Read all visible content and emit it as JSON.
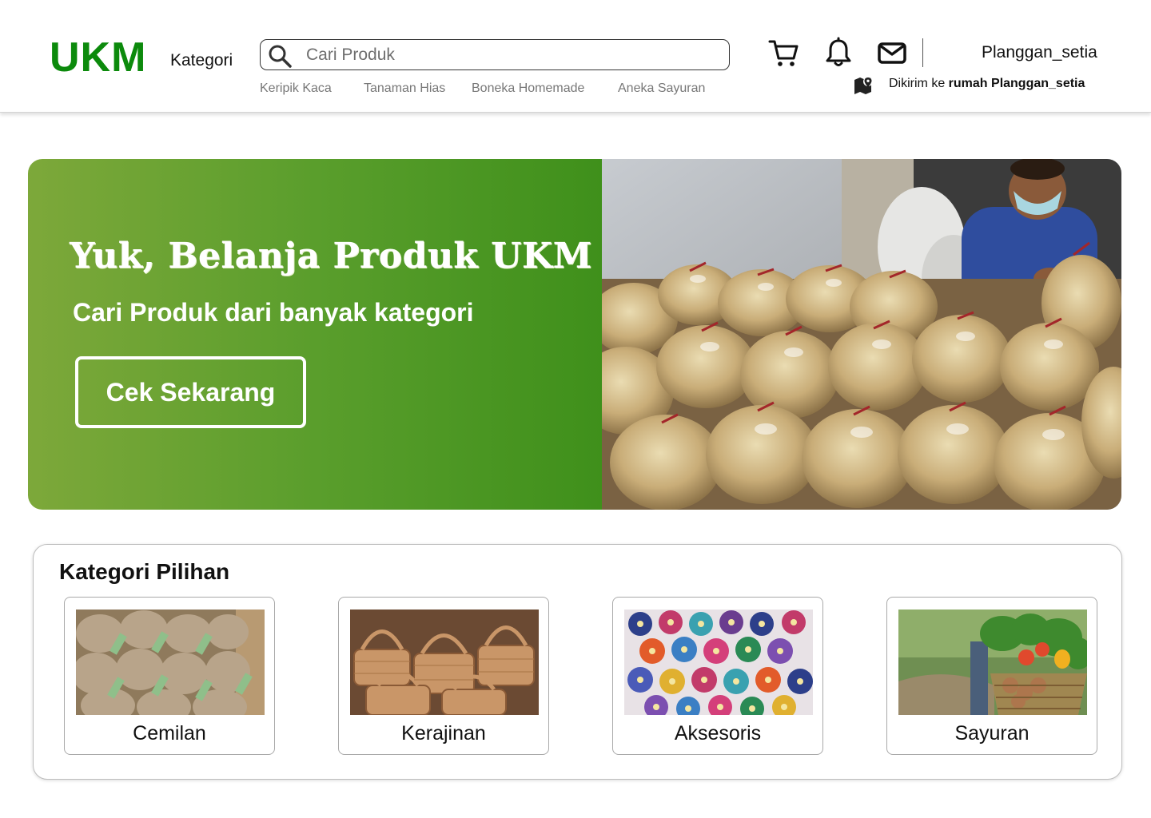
{
  "header": {
    "logo": "UKM",
    "kategori_label": "Kategori",
    "search": {
      "placeholder": "Cari Produk",
      "value": ""
    },
    "quick_links": [
      "Keripik Kaca",
      "Tanaman Hias",
      "Boneka Homemade",
      "Aneka Sayuran"
    ],
    "icons": [
      "cart-icon",
      "bell-icon",
      "mail-icon"
    ],
    "user_name": "Planggan_setia",
    "delivery": {
      "prefix": "Dikirim ke ",
      "address": "rumah Planggan_setia"
    }
  },
  "banner": {
    "title": "Yuk, Belanja Produk UKM",
    "subtitle": "Cari Produk dari banyak kategori",
    "cta_label": "Cek Sekarang"
  },
  "kategori": {
    "title": "Kategori Pilihan",
    "items": [
      {
        "label": "Cemilan"
      },
      {
        "label": "Kerajinan"
      },
      {
        "label": "Aksesoris"
      },
      {
        "label": "Sayuran"
      }
    ]
  },
  "colors": {
    "brand_green": "#0c8a0c",
    "banner_gradient_start": "#7da83a",
    "banner_gradient_end": "#3f901b"
  }
}
